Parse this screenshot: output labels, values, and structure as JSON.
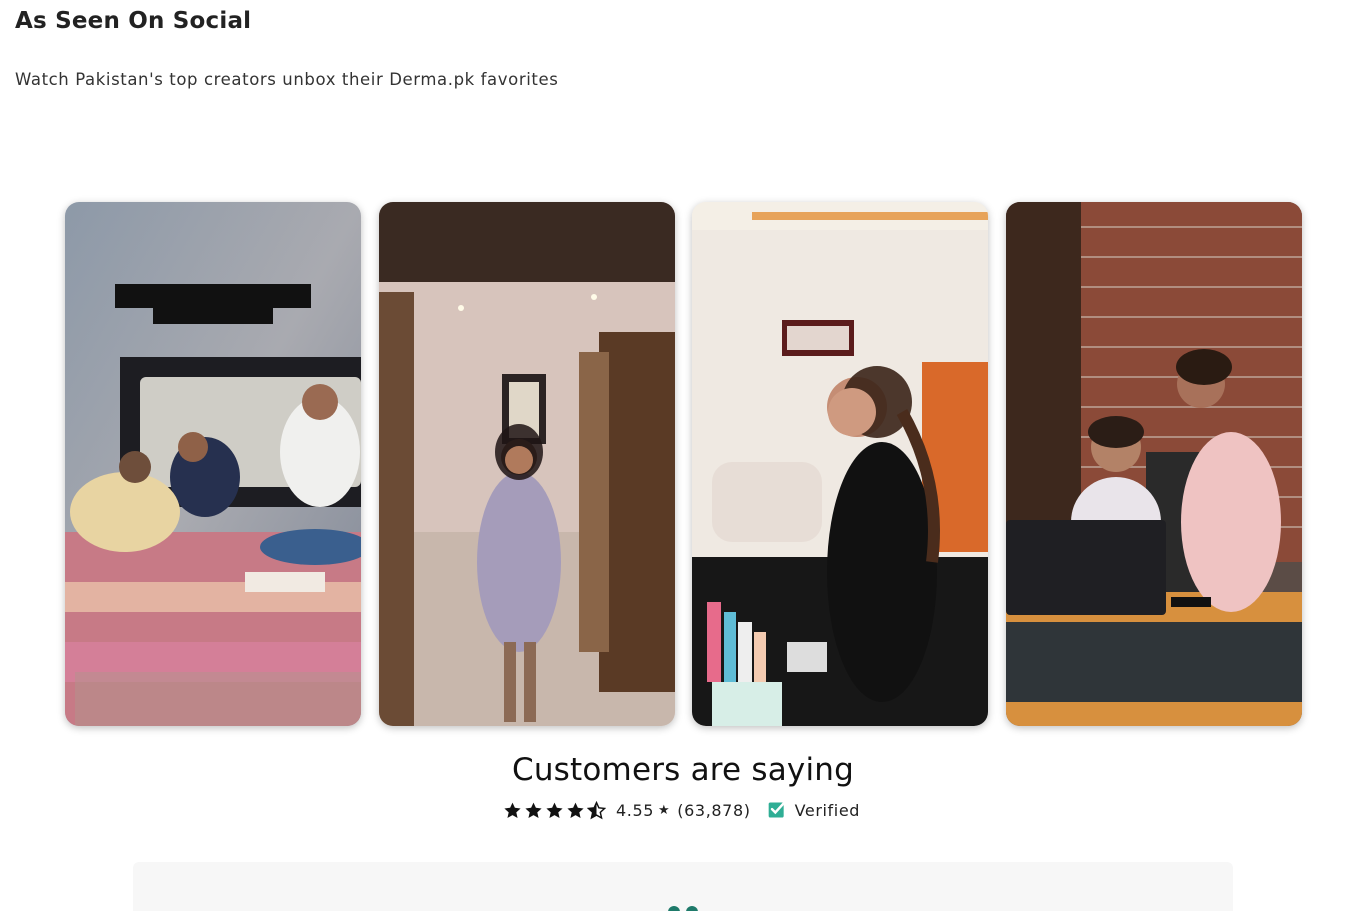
{
  "section": {
    "title": "As Seen On Social",
    "subtitle": "Watch Pakistan's top creators unbox their Derma.pk favorites"
  },
  "videos": [
    {
      "icon": "video-thumbnail-bedroom-group"
    },
    {
      "icon": "video-thumbnail-hallway-woman"
    },
    {
      "icon": "video-thumbnail-livingroom-woman"
    },
    {
      "icon": "video-thumbnail-office-laptop"
    }
  ],
  "reviews": {
    "title": "Customers are saying",
    "rating": "4.55",
    "star_glyph": "★",
    "count": "(63,878)",
    "verified_label": "Verified",
    "stars_value": 4.55,
    "accent_color": "#2fae95",
    "quote_color": "#1e7a6a"
  }
}
